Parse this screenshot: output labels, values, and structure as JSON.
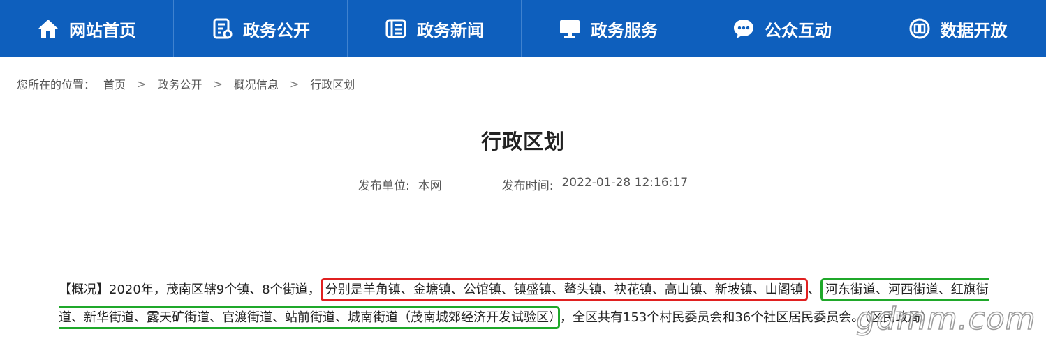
{
  "nav": {
    "items": [
      {
        "label": "网站首页",
        "icon": "home-icon"
      },
      {
        "label": "政务公开",
        "icon": "document-icon"
      },
      {
        "label": "政务新闻",
        "icon": "news-icon"
      },
      {
        "label": "政务服务",
        "icon": "monitor-icon"
      },
      {
        "label": "公众互动",
        "icon": "chat-icon"
      },
      {
        "label": "数据开放",
        "icon": "data-icon"
      }
    ],
    "background_color": "#0e5fbd"
  },
  "breadcrumb": {
    "prefix": "您所在的位置：",
    "items": [
      "首页",
      "政务公开",
      "概况信息",
      "行政区划"
    ],
    "separator": ">"
  },
  "article": {
    "title": "行政区划",
    "publisher_label": "发布单位:",
    "publisher": "本网",
    "time_label": "发布时间:",
    "time": "2022-01-28 12:16:17",
    "paragraph": {
      "intro": "【概况】2020年，茂南区辖9个镇、8个街道，",
      "towns": "分别是羊角镇、金塘镇、公馆镇、镇盛镇、鳌头镇、袂花镇、高山镇、新坡镇、山阁镇",
      "sep": "、",
      "streets": "河东街道、河西街道、红旗街道、新华街道、露天矿街道、官渡街道、站前街道、城南街道（茂南城郊经济开发试验区）",
      "outro": "，全区共有153个村民委员会和36个社区居民委员会。（区民政局）"
    },
    "highlight_colors": {
      "towns": "#e02020",
      "streets": "#1fa82a"
    }
  },
  "watermark": {
    "text": "gdmm.com"
  }
}
